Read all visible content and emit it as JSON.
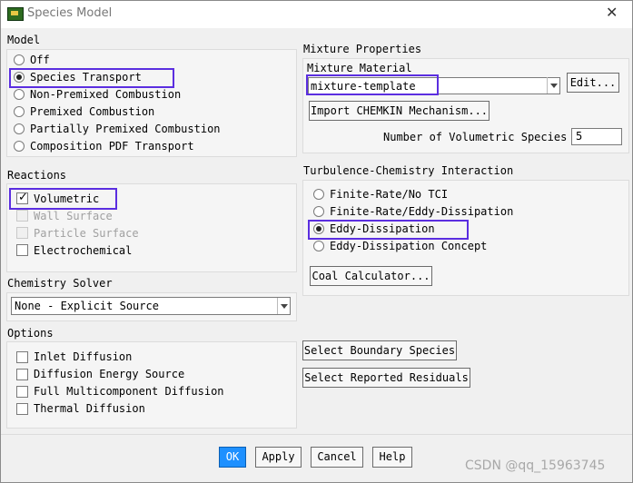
{
  "window": {
    "title": "Species Model"
  },
  "model": {
    "heading": "Model",
    "options": [
      "Off",
      "Species Transport",
      "Non-Premixed Combustion",
      "Premixed Combustion",
      "Partially Premixed Combustion",
      "Composition PDF Transport"
    ],
    "selected": "Species Transport"
  },
  "reactions": {
    "heading": "Reactions",
    "items": [
      {
        "label": "Volumetric",
        "checked": true,
        "enabled": true
      },
      {
        "label": "Wall Surface",
        "checked": false,
        "enabled": false
      },
      {
        "label": "Particle Surface",
        "checked": false,
        "enabled": false
      },
      {
        "label": "Electrochemical",
        "checked": false,
        "enabled": true
      }
    ]
  },
  "chemistry_solver": {
    "heading": "Chemistry Solver",
    "value": "None - Explicit Source"
  },
  "options": {
    "heading": "Options",
    "items": [
      "Inlet Diffusion",
      "Diffusion Energy Source",
      "Full Multicomponent Diffusion",
      "Thermal Diffusion"
    ]
  },
  "mixture": {
    "heading": "Mixture Properties",
    "material_label": "Mixture Material",
    "material_value": "mixture-template",
    "edit_button": "Edit...",
    "import_button": "Import CHEMKIN Mechanism...",
    "num_species_label": "Number of Volumetric Species",
    "num_species_value": "5"
  },
  "tci": {
    "heading": "Turbulence-Chemistry Interaction",
    "options": [
      "Finite-Rate/No TCI",
      "Finite-Rate/Eddy-Dissipation",
      "Eddy-Dissipation",
      "Eddy-Dissipation Concept"
    ],
    "selected": "Eddy-Dissipation",
    "coal_button": "Coal Calculator..."
  },
  "side_buttons": {
    "boundary": "Select Boundary Species",
    "residuals": "Select Reported Residuals"
  },
  "footer": {
    "ok": "OK",
    "apply": "Apply",
    "cancel": "Cancel",
    "help": "Help"
  },
  "watermark": "CSDN @qq_15963745",
  "colors": {
    "highlight": "#5b2ee0",
    "ok_button": "#1e90ff"
  }
}
